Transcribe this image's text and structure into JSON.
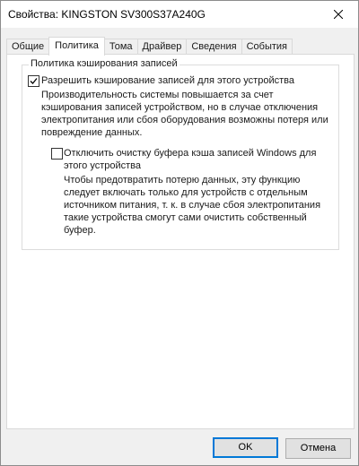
{
  "window": {
    "title": "Свойства: KINGSTON SV300S37A240G"
  },
  "tabs": [
    {
      "label": "Общие"
    },
    {
      "label": "Политика"
    },
    {
      "label": "Тома"
    },
    {
      "label": "Драйвер"
    },
    {
      "label": "Сведения"
    },
    {
      "label": "События"
    }
  ],
  "active_tab": "Политика",
  "policy": {
    "group_title": "Политика кэширования записей",
    "write_cache": {
      "label": "Разрешить кэширование записей для этого устройства",
      "checked": true,
      "description_lines": [
        "Производительность системы повышается за счет",
        "кэширования записей устройством, но в случае отключения",
        "электропитания или сбоя оборудования возможны потеря или",
        "повреждение данных."
      ]
    },
    "flush_buffer": {
      "label_lines": [
        "Отключить очистку буфера кэша записей Windows для",
        "этого устройства"
      ],
      "checked": false,
      "description_lines": [
        "Чтобы предотвратить потерю данных, эту функцию",
        "следует включать только для устройств с отдельным",
        "источником питания, т. к.  в случае сбоя электропитания",
        "такие устройства смогут сами очистить собственный",
        "буфер."
      ]
    }
  },
  "buttons": {
    "ok": "OK",
    "cancel": "Отмена"
  },
  "colors": {
    "accent": "#0078d7"
  }
}
